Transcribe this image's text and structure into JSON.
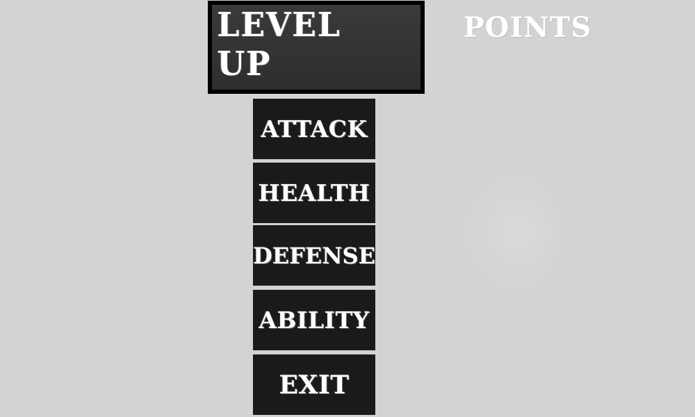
{
  "screen": {
    "title": "LEVEL UP",
    "points_label": "POINTS"
  },
  "menu": {
    "items": [
      {
        "id": "attack",
        "label": "ATTACK"
      },
      {
        "id": "health",
        "label": "HEALTH"
      },
      {
        "id": "defense",
        "label": "DEFENSE"
      },
      {
        "id": "ability",
        "label": "ABILITY"
      },
      {
        "id": "exit",
        "label": "EXIT"
      }
    ]
  },
  "colors": {
    "background": "#d3d3d3",
    "button_bg": "#1a1a1a",
    "title_bg": "#333333",
    "text": "#ffffff"
  }
}
